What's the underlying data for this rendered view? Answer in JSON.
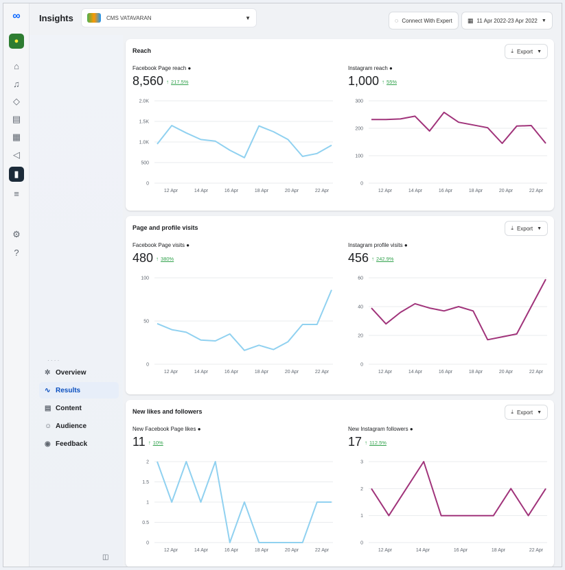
{
  "header": {
    "title": "Insights",
    "account_name": "CMS VATAVARAN",
    "connect_label": "Connect With Expert",
    "date_range": "11 Apr 2022-23 Apr 2022"
  },
  "nav": {
    "items": [
      {
        "label": "Overview",
        "icon": "overview-icon"
      },
      {
        "label": "Results",
        "icon": "results-icon"
      },
      {
        "label": "Content",
        "icon": "content-icon"
      },
      {
        "label": "Audience",
        "icon": "audience-icon"
      },
      {
        "label": "Feedback",
        "icon": "feedback-icon"
      }
    ],
    "selected": "Results"
  },
  "colors": {
    "facebook_line": "#90d1f0",
    "instagram_line": "#a0337a",
    "accent": "#0866ff",
    "positive": "#31a24c"
  },
  "cards": [
    {
      "title": "Reach",
      "export_label": "Export",
      "metrics": [
        {
          "label": "Facebook Page reach",
          "value": "8,560",
          "change": "217.5%"
        },
        {
          "label": "Instagram reach",
          "value": "1,000",
          "change": "55%"
        }
      ]
    },
    {
      "title": "Page and profile visits",
      "export_label": "Export",
      "metrics": [
        {
          "label": "Facebook Page visits",
          "value": "480",
          "change": "380%"
        },
        {
          "label": "Instagram profile visits",
          "value": "456",
          "change": "242.9%"
        }
      ]
    },
    {
      "title": "New likes and followers",
      "export_label": "Export",
      "metrics": [
        {
          "label": "New Facebook Page likes",
          "value": "11",
          "change": "10%"
        },
        {
          "label": "New Instagram followers",
          "value": "17",
          "change": "112.5%"
        }
      ]
    }
  ],
  "chart_data": [
    {
      "type": "line",
      "series": [
        {
          "values": [
            950,
            1400,
            1220,
            1060,
            1020,
            800,
            620,
            1390,
            1250,
            1060,
            650,
            720,
            920
          ]
        }
      ],
      "x_ticks": [
        "12 Apr",
        "14 Apr",
        "16 Apr",
        "18 Apr",
        "20 Apr",
        "22 Apr"
      ],
      "y_ticks": [
        "2.0K",
        "1.5K",
        "1.0K",
        "500",
        "0"
      ],
      "ylim": [
        0,
        2000
      ],
      "color": "#90d1f0"
    },
    {
      "type": "line",
      "series": [
        {
          "values": [
            232,
            232,
            234,
            244,
            190,
            258,
            222,
            212,
            202,
            145,
            208,
            210,
            145
          ]
        }
      ],
      "x_ticks": [
        "12 Apr",
        "14 Apr",
        "16 Apr",
        "18 Apr",
        "20 Apr",
        "22 Apr"
      ],
      "y_ticks": [
        "300",
        "200",
        "100",
        "0"
      ],
      "ylim": [
        0,
        300
      ],
      "color": "#a0337a"
    },
    {
      "type": "line",
      "series": [
        {
          "values": [
            47,
            40,
            37,
            28,
            27,
            35,
            16,
            22,
            17,
            26,
            46,
            46,
            86
          ]
        }
      ],
      "x_ticks": [
        "12 Apr",
        "14 Apr",
        "16 Apr",
        "18 Apr",
        "20 Apr",
        "22 Apr"
      ],
      "y_ticks": [
        "100",
        "50",
        "0"
      ],
      "ylim": [
        0,
        100
      ],
      "color": "#90d1f0"
    },
    {
      "type": "line",
      "series": [
        {
          "values": [
            39,
            28,
            36,
            42,
            39,
            37,
            40,
            37,
            17,
            19,
            21,
            40,
            59
          ]
        }
      ],
      "x_ticks": [
        "12 Apr",
        "14 Apr",
        "16 Apr",
        "18 Apr",
        "20 Apr",
        "22 Apr"
      ],
      "y_ticks": [
        "60",
        "40",
        "20",
        "0"
      ],
      "ylim": [
        0,
        60
      ],
      "color": "#a0337a"
    },
    {
      "type": "line",
      "series": [
        {
          "values": [
            2,
            1,
            2,
            1,
            2,
            0,
            1,
            0,
            0,
            0,
            0,
            1,
            1
          ]
        }
      ],
      "x_ticks": [
        "12 Apr",
        "14 Apr",
        "16 Apr",
        "18 Apr",
        "20 Apr",
        "22 Apr"
      ],
      "y_ticks": [
        "2",
        "1.5",
        "1",
        "0.5",
        "0"
      ],
      "ylim": [
        0,
        2
      ],
      "color": "#90d1f0"
    },
    {
      "type": "line",
      "series": [
        {
          "values": [
            2,
            1,
            2,
            3,
            1,
            1,
            1,
            1,
            2,
            1,
            2
          ]
        }
      ],
      "x_ticks": [
        "12 Apr",
        "14 Apr",
        "16 Apr",
        "18 Apr",
        "22 Apr"
      ],
      "y_ticks": [
        "3",
        "2",
        "1",
        "0"
      ],
      "ylim": [
        0,
        3
      ],
      "color": "#a0337a"
    }
  ]
}
